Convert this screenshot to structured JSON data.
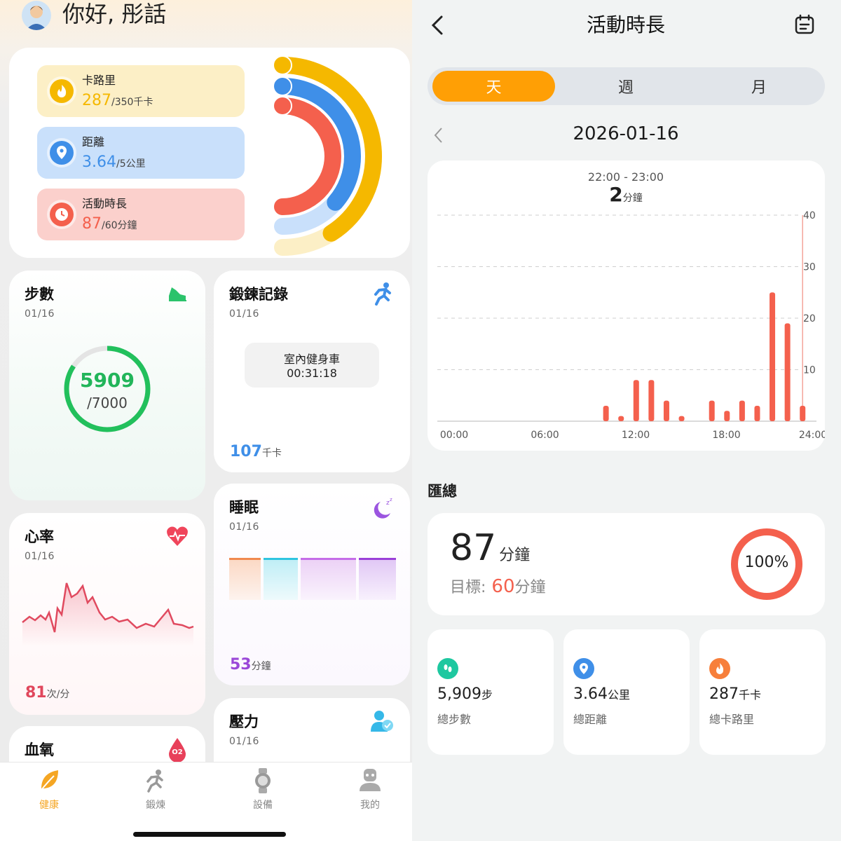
{
  "greeting": "你好, 彤話",
  "rings": [
    {
      "label": "卡路里",
      "value": "287",
      "target": "/350千卡",
      "color": "#f5b800",
      "bg": "#fcefc6",
      "progress": 0.82
    },
    {
      "label": "距離",
      "value": "3.64",
      "target": "/5公里",
      "color": "#3f8fe8",
      "bg": "#c9e0fb",
      "progress": 0.728
    },
    {
      "label": "活動時長",
      "value": "87",
      "target": "/60分鐘",
      "color": "#f4604d",
      "bg": "#fbd0cc",
      "progress": 1.0
    }
  ],
  "steps": {
    "title": "步數",
    "date": "01/16",
    "value": "5909",
    "goal": "/7000",
    "progress": 0.844
  },
  "workout": {
    "title": "鍛鍊記錄",
    "date": "01/16",
    "activity": "室內健身車",
    "duration": "00:31:18",
    "kcal": "107",
    "kcal_unit": "千卡"
  },
  "heart": {
    "title": "心率",
    "date": "01/16",
    "value": "81",
    "unit": "次/分"
  },
  "sleep": {
    "title": "睡眠",
    "date": "01/16",
    "value": "53",
    "unit": "分鐘"
  },
  "spo2": {
    "title": "血氧",
    "badge": "O2"
  },
  "stress": {
    "title": "壓力",
    "date": "01/16"
  },
  "nav": [
    {
      "label": "健康",
      "color": "#f5a623"
    },
    {
      "label": "鍛煉",
      "color": "#888888"
    },
    {
      "label": "設備",
      "color": "#888888"
    },
    {
      "label": "我的",
      "color": "#888888"
    }
  ],
  "detail": {
    "title": "活動時長",
    "tabs": [
      "天",
      "週",
      "月"
    ],
    "active_tab": "天",
    "date": "2026-01-16",
    "tooltip_range": "22:00 - 23:00",
    "tooltip_value": "2",
    "tooltip_unit": "分鐘",
    "summary_heading": "匯總",
    "total": "87",
    "total_unit": "分鐘",
    "goal_label": "目標:",
    "goal_value": "60",
    "goal_unit": "分鐘",
    "percent": "100%",
    "stats": [
      {
        "value": "5,909",
        "unit": "步",
        "label": "總步數",
        "color": "#1ec8a0"
      },
      {
        "value": "3.64",
        "unit": "公里",
        "label": "總距離",
        "color": "#3f8fe8"
      },
      {
        "value": "287",
        "unit": "千卡",
        "label": "總卡路里",
        "color": "#f77f3b"
      }
    ]
  },
  "chart_data": {
    "type": "bar",
    "x": [
      10,
      11,
      12,
      13,
      14,
      15,
      17,
      18,
      19,
      20,
      21,
      22,
      23
    ],
    "values": [
      3,
      1,
      8,
      8,
      4,
      1,
      4,
      2,
      4,
      3,
      25,
      19,
      3
    ],
    "highlight_x": 23,
    "ylim": [
      0,
      40
    ],
    "yticks": [
      10,
      20,
      30,
      40
    ],
    "xticks": [
      "00:00",
      "06:00",
      "12:00",
      "18:00",
      "24:00"
    ],
    "grid": true,
    "bar_color": "#f4604d"
  }
}
